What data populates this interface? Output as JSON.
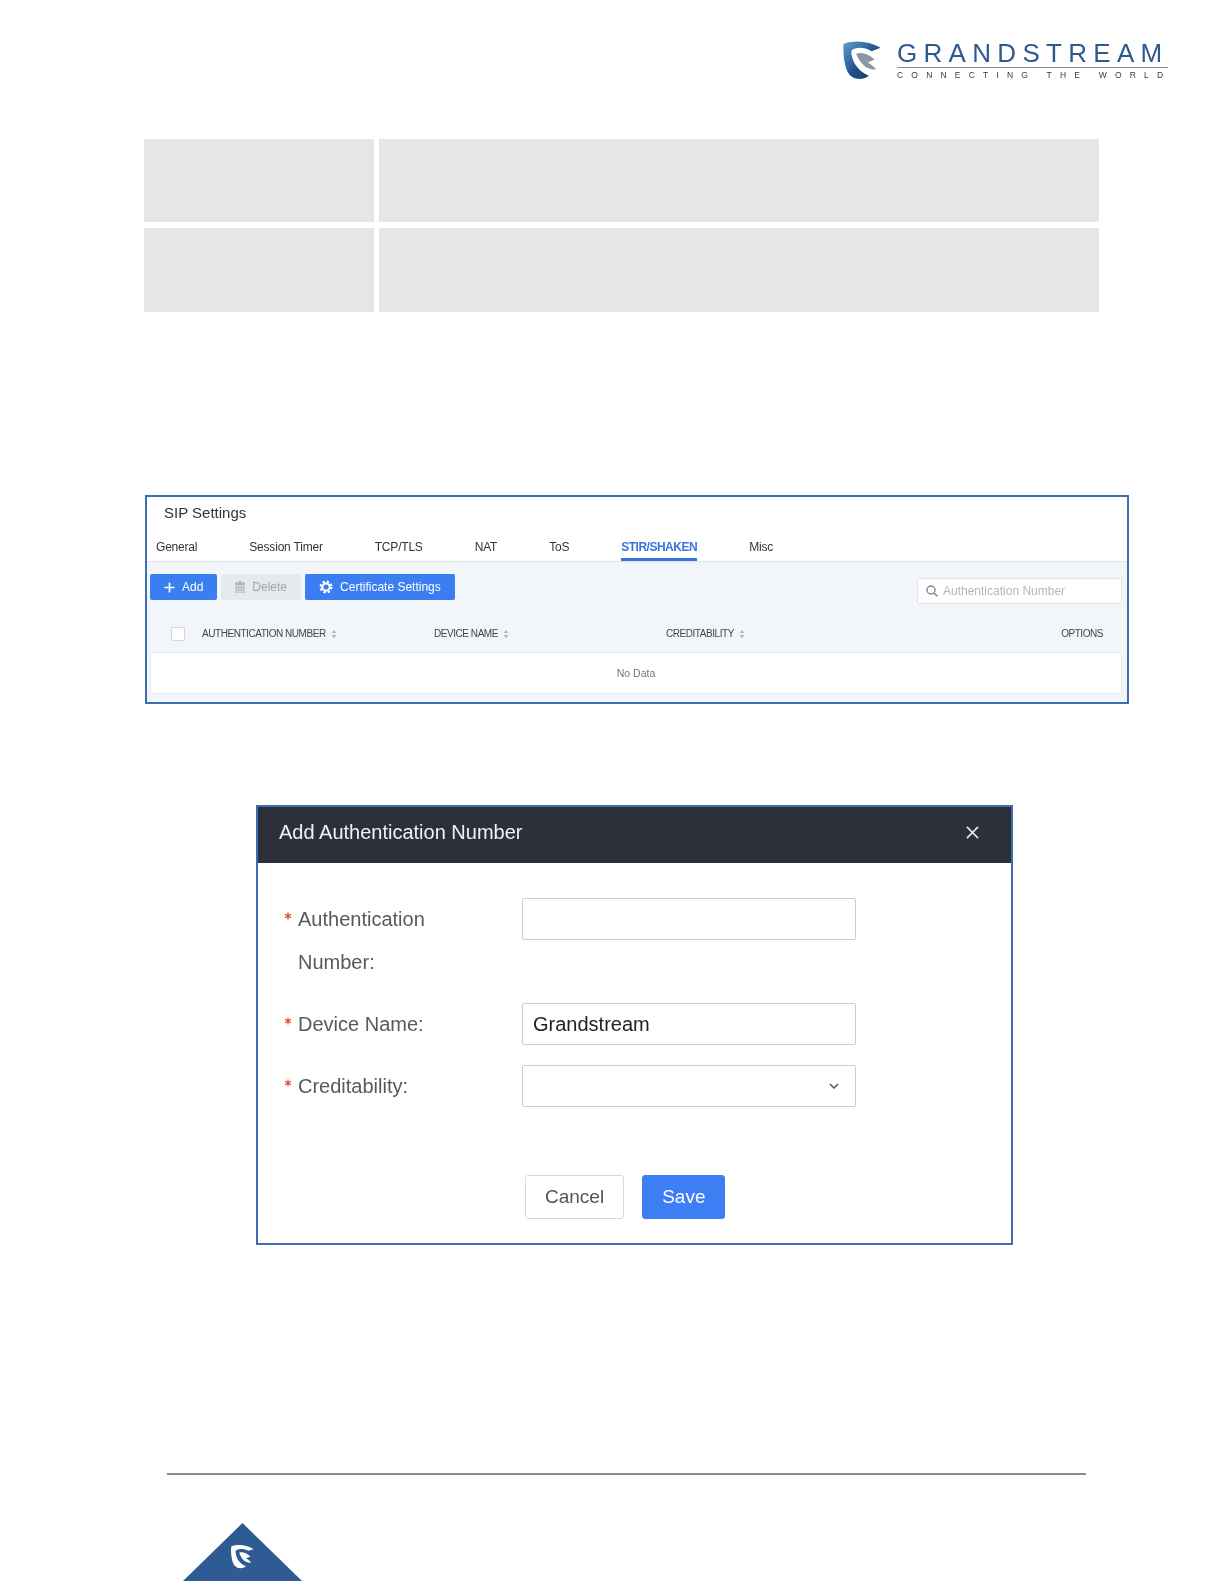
{
  "header": {
    "logo": {
      "wordmark": "GRANDSTREAM",
      "tagline": "CONNECTING THE WORLD"
    }
  },
  "sip_settings": {
    "title": "SIP Settings",
    "tabs": [
      {
        "label": "General",
        "selected": false
      },
      {
        "label": "Session Timer",
        "selected": false
      },
      {
        "label": "TCP/TLS",
        "selected": false
      },
      {
        "label": "NAT",
        "selected": false
      },
      {
        "label": "ToS",
        "selected": false
      },
      {
        "label": "STIR/SHAKEN",
        "selected": true
      },
      {
        "label": "Misc",
        "selected": false
      }
    ],
    "toolbar": {
      "buttons": [
        {
          "label": "Add",
          "kind": "add",
          "disabled": false
        },
        {
          "label": "Delete",
          "kind": "delete",
          "disabled": true
        },
        {
          "label": "Certificate Settings",
          "kind": "settings",
          "disabled": false
        }
      ],
      "search": {
        "placeholder": "Authentication Number"
      }
    },
    "table": {
      "select_all": {
        "checked": false
      },
      "columns": [
        {
          "label": "AUTHENTICATION NUMBER",
          "sortable": true
        },
        {
          "label": "DEVICE NAME",
          "sortable": true
        },
        {
          "label": "CREDITABILITY",
          "sortable": true
        },
        {
          "label": "OPTIONS",
          "sortable": false
        }
      ],
      "empty_text": "No Data"
    }
  },
  "dialog": {
    "title": "Add Authentication Number",
    "fields": [
      {
        "label": "Authentication Number:",
        "required": true,
        "kind": "text"
      },
      {
        "label": "Device Name:",
        "required": true,
        "kind": "text",
        "value": "Grandstream"
      },
      {
        "label": "Creditability:",
        "required": true,
        "kind": "select"
      }
    ],
    "buttons": [
      {
        "label": "Cancel",
        "kind": "cancel"
      },
      {
        "label": "Save",
        "kind": "save"
      }
    ]
  }
}
